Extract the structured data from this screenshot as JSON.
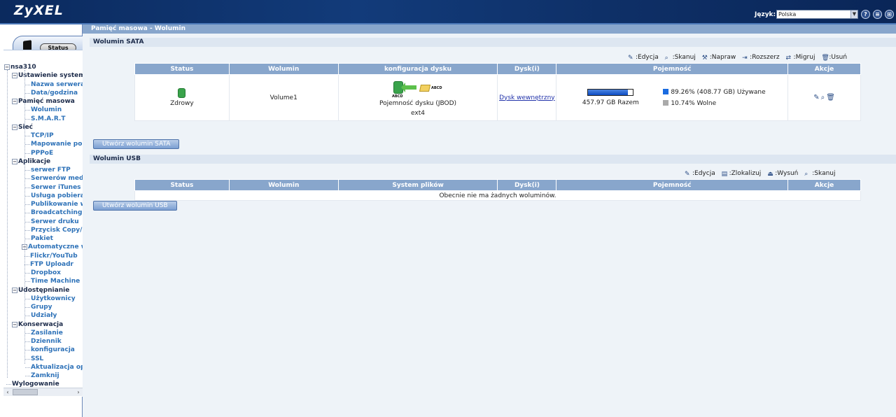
{
  "header": {
    "logo": "ZyXEL",
    "language_label": "Język:",
    "language_value": "Polska",
    "icons": [
      "help-icon",
      "sitemap-icon",
      "logout-icon"
    ],
    "icon_glyphs": [
      "?",
      "≡",
      "⊞"
    ]
  },
  "sidebar": {
    "status_tab": "Status",
    "root": "nsa310",
    "items": [
      {
        "label": "Ustawienie systemu",
        "level": 1
      },
      {
        "label": "Nazwa serwera",
        "level": 2
      },
      {
        "label": "Data/godzina",
        "level": 2
      },
      {
        "label": "Pamięć masowa",
        "level": 1
      },
      {
        "label": "Wolumin",
        "level": 2
      },
      {
        "label": "S.M.A.R.T",
        "level": 2
      },
      {
        "label": "Sieć",
        "level": 1
      },
      {
        "label": "TCP/IP",
        "level": 2
      },
      {
        "label": "Mapowanie portów",
        "level": 2
      },
      {
        "label": "PPPoE",
        "level": 2
      },
      {
        "label": "Aplikacje",
        "level": 1
      },
      {
        "label": "serwer FTP",
        "level": 2
      },
      {
        "label": "Serwerów medió",
        "level": 2
      },
      {
        "label": "Serwer iTunes",
        "level": 2
      },
      {
        "label": "Usługa pobierania",
        "level": 2
      },
      {
        "label": "Publikowanie w s",
        "level": 2
      },
      {
        "label": "Broadcatching",
        "level": 2
      },
      {
        "label": "Serwer druku",
        "level": 2
      },
      {
        "label": "Przycisk Copy/S",
        "level": 2
      },
      {
        "label": "Pakiet",
        "level": 2
      },
      {
        "label": "Automatyczne w",
        "level": 2
      },
      {
        "label": "Flickr/YouTub",
        "level": 3
      },
      {
        "label": "FTP Uploadr",
        "level": 3
      },
      {
        "label": "Dropbox",
        "level": 2
      },
      {
        "label": "Time Machine",
        "level": 2
      },
      {
        "label": "Udostępnianie",
        "level": 1
      },
      {
        "label": "Użytkownicy",
        "level": 2
      },
      {
        "label": "Grupy",
        "level": 2
      },
      {
        "label": "Udziały",
        "level": 2
      },
      {
        "label": "Konserwacja",
        "level": 1
      },
      {
        "label": "Zasilanie",
        "level": 2
      },
      {
        "label": "Dziennik",
        "level": 2
      },
      {
        "label": "konfiguracja",
        "level": 2
      },
      {
        "label": "SSL",
        "level": 2
      },
      {
        "label": "Aktualizacja oprogr",
        "level": 2
      },
      {
        "label": "Zamknij",
        "level": 2
      },
      {
        "label": "Wylogowanie",
        "level": 1
      }
    ]
  },
  "main": {
    "page_title": "Pamięć masowa - Wolumin",
    "sata": {
      "section_title": "Wolumin SATA",
      "toolbar": [
        {
          "icon": "edit-icon",
          "label": ":Edycja"
        },
        {
          "icon": "scan-icon",
          "label": ":Skanuj"
        },
        {
          "icon": "repair-icon",
          "label": ":Napraw"
        },
        {
          "icon": "expand-icon",
          "label": ":Rozszerz"
        },
        {
          "icon": "migrate-icon",
          "label": ":Migruj"
        },
        {
          "icon": "delete-icon",
          "label": ":Usuń"
        }
      ],
      "columns": [
        "Status",
        "Wolumin",
        "konfiguracja dysku",
        "Dysk(i)",
        "Pojemność",
        "Akcje"
      ],
      "row": {
        "status": "Zdrowy",
        "volume": "Volume1",
        "disk_label_a": "ABCD",
        "disk_label_b": "ABCD",
        "config": "Pojemność dysku (JBOD)",
        "fs": "ext4",
        "disks": "Dysk wewnętrzny",
        "total": "457.97 GB Razem",
        "used": "89.26% (408.77 GB) Używane",
        "free": "10.74% Wolne",
        "used_fraction": 0.8926
      },
      "create_button": "Utwórz wolumin SATA"
    },
    "usb": {
      "section_title": "Wolumin USB",
      "toolbar": [
        {
          "icon": "edit-icon",
          "label": ":Edycja"
        },
        {
          "icon": "locate-icon",
          "label": ":Zlokalizuj"
        },
        {
          "icon": "eject-icon",
          "label": ":Wysuń"
        },
        {
          "icon": "scan-icon",
          "label": ":Skanuj"
        }
      ],
      "columns": [
        "Status",
        "Wolumin",
        "System plików",
        "Dysk(i)",
        "Pojemność",
        "Akcje"
      ],
      "empty_message": "Obecnie nie ma żadnych woluminów.",
      "create_button": "Utwórz wolumin USB"
    }
  },
  "colors": {
    "header_bg": "#123b7a",
    "table_header": "#88a6cc",
    "main_bg": "#eef3f8",
    "link": "#2233aa",
    "menu_link": "#2e72b8"
  }
}
